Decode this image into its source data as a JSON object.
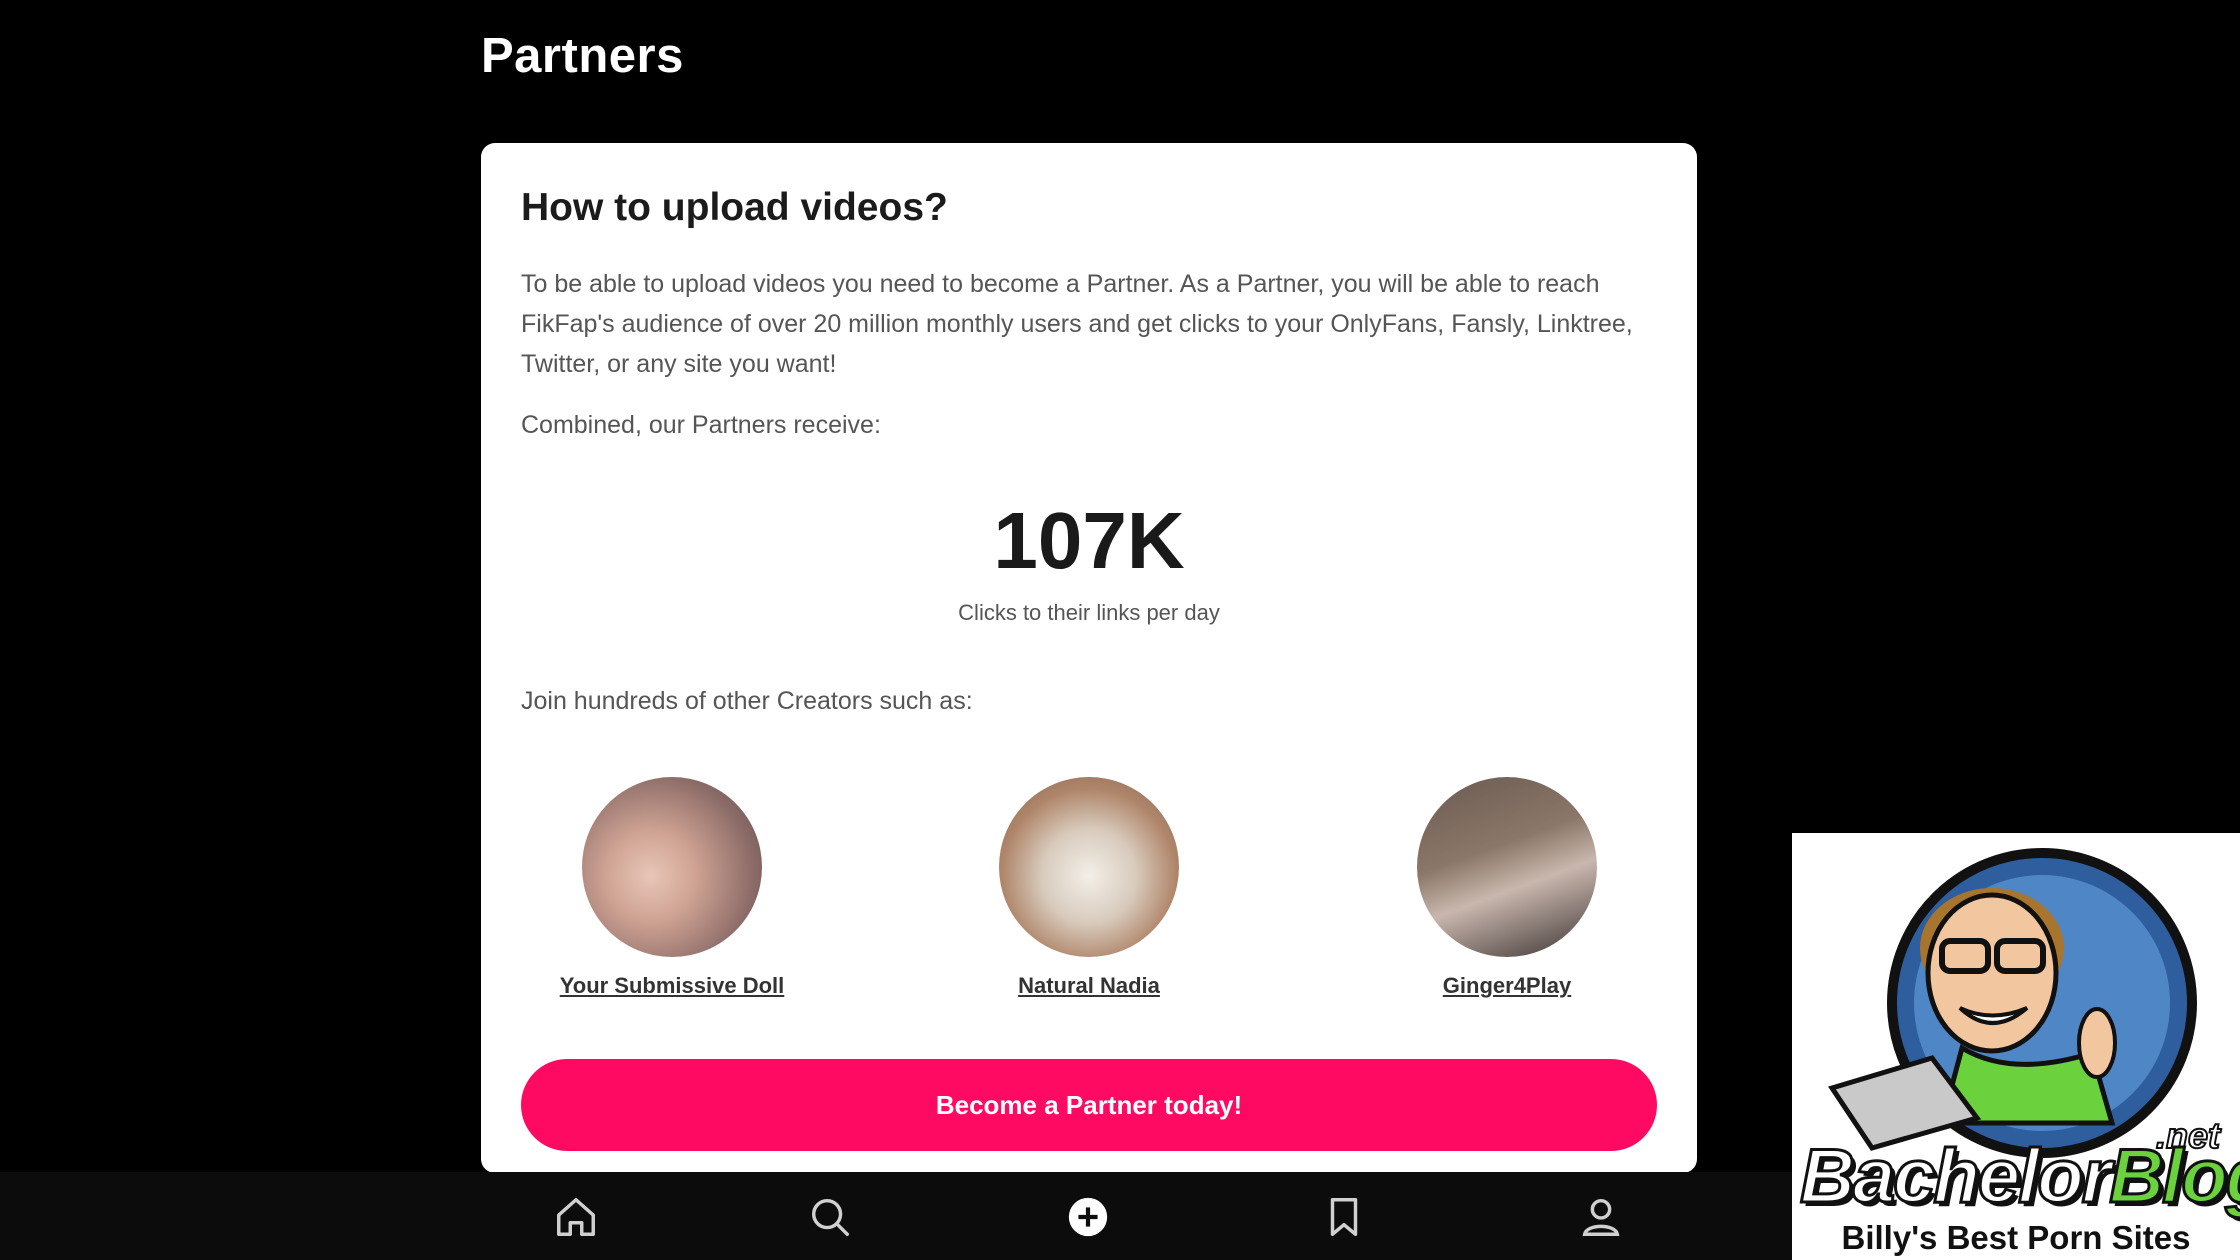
{
  "page": {
    "title": "Partners"
  },
  "card": {
    "heading": "How to upload videos?",
    "description": "To be able to upload videos you need to become a Partner. As a Partner, you will be able to reach FikFap's audience of over 20 million monthly users and get clicks to your OnlyFans, Fansly, Linktree, Twitter, or any site you want!",
    "combined_label": "Combined, our Partners receive:",
    "stat_value": "107K",
    "stat_caption": "Clicks to their links per day",
    "join_label": "Join hundreds of other Creators such as:",
    "creators": [
      {
        "name": "Your Submissive Doll"
      },
      {
        "name": "Natural Nadia"
      },
      {
        "name": "Ginger4Play"
      }
    ],
    "cta_label": "Become a Partner today!",
    "accent_color": "#ff0a63"
  },
  "bottom_nav": {
    "items": [
      {
        "icon": "home-icon"
      },
      {
        "icon": "search-icon"
      },
      {
        "icon": "add-icon"
      },
      {
        "icon": "bookmark-icon"
      },
      {
        "icon": "profile-icon"
      }
    ]
  },
  "watermark": {
    "brand_part1": "Bachelor",
    "brand_part2": "Blog",
    "domain_suffix": ".net",
    "tagline": "Billy's Best Porn Sites"
  }
}
